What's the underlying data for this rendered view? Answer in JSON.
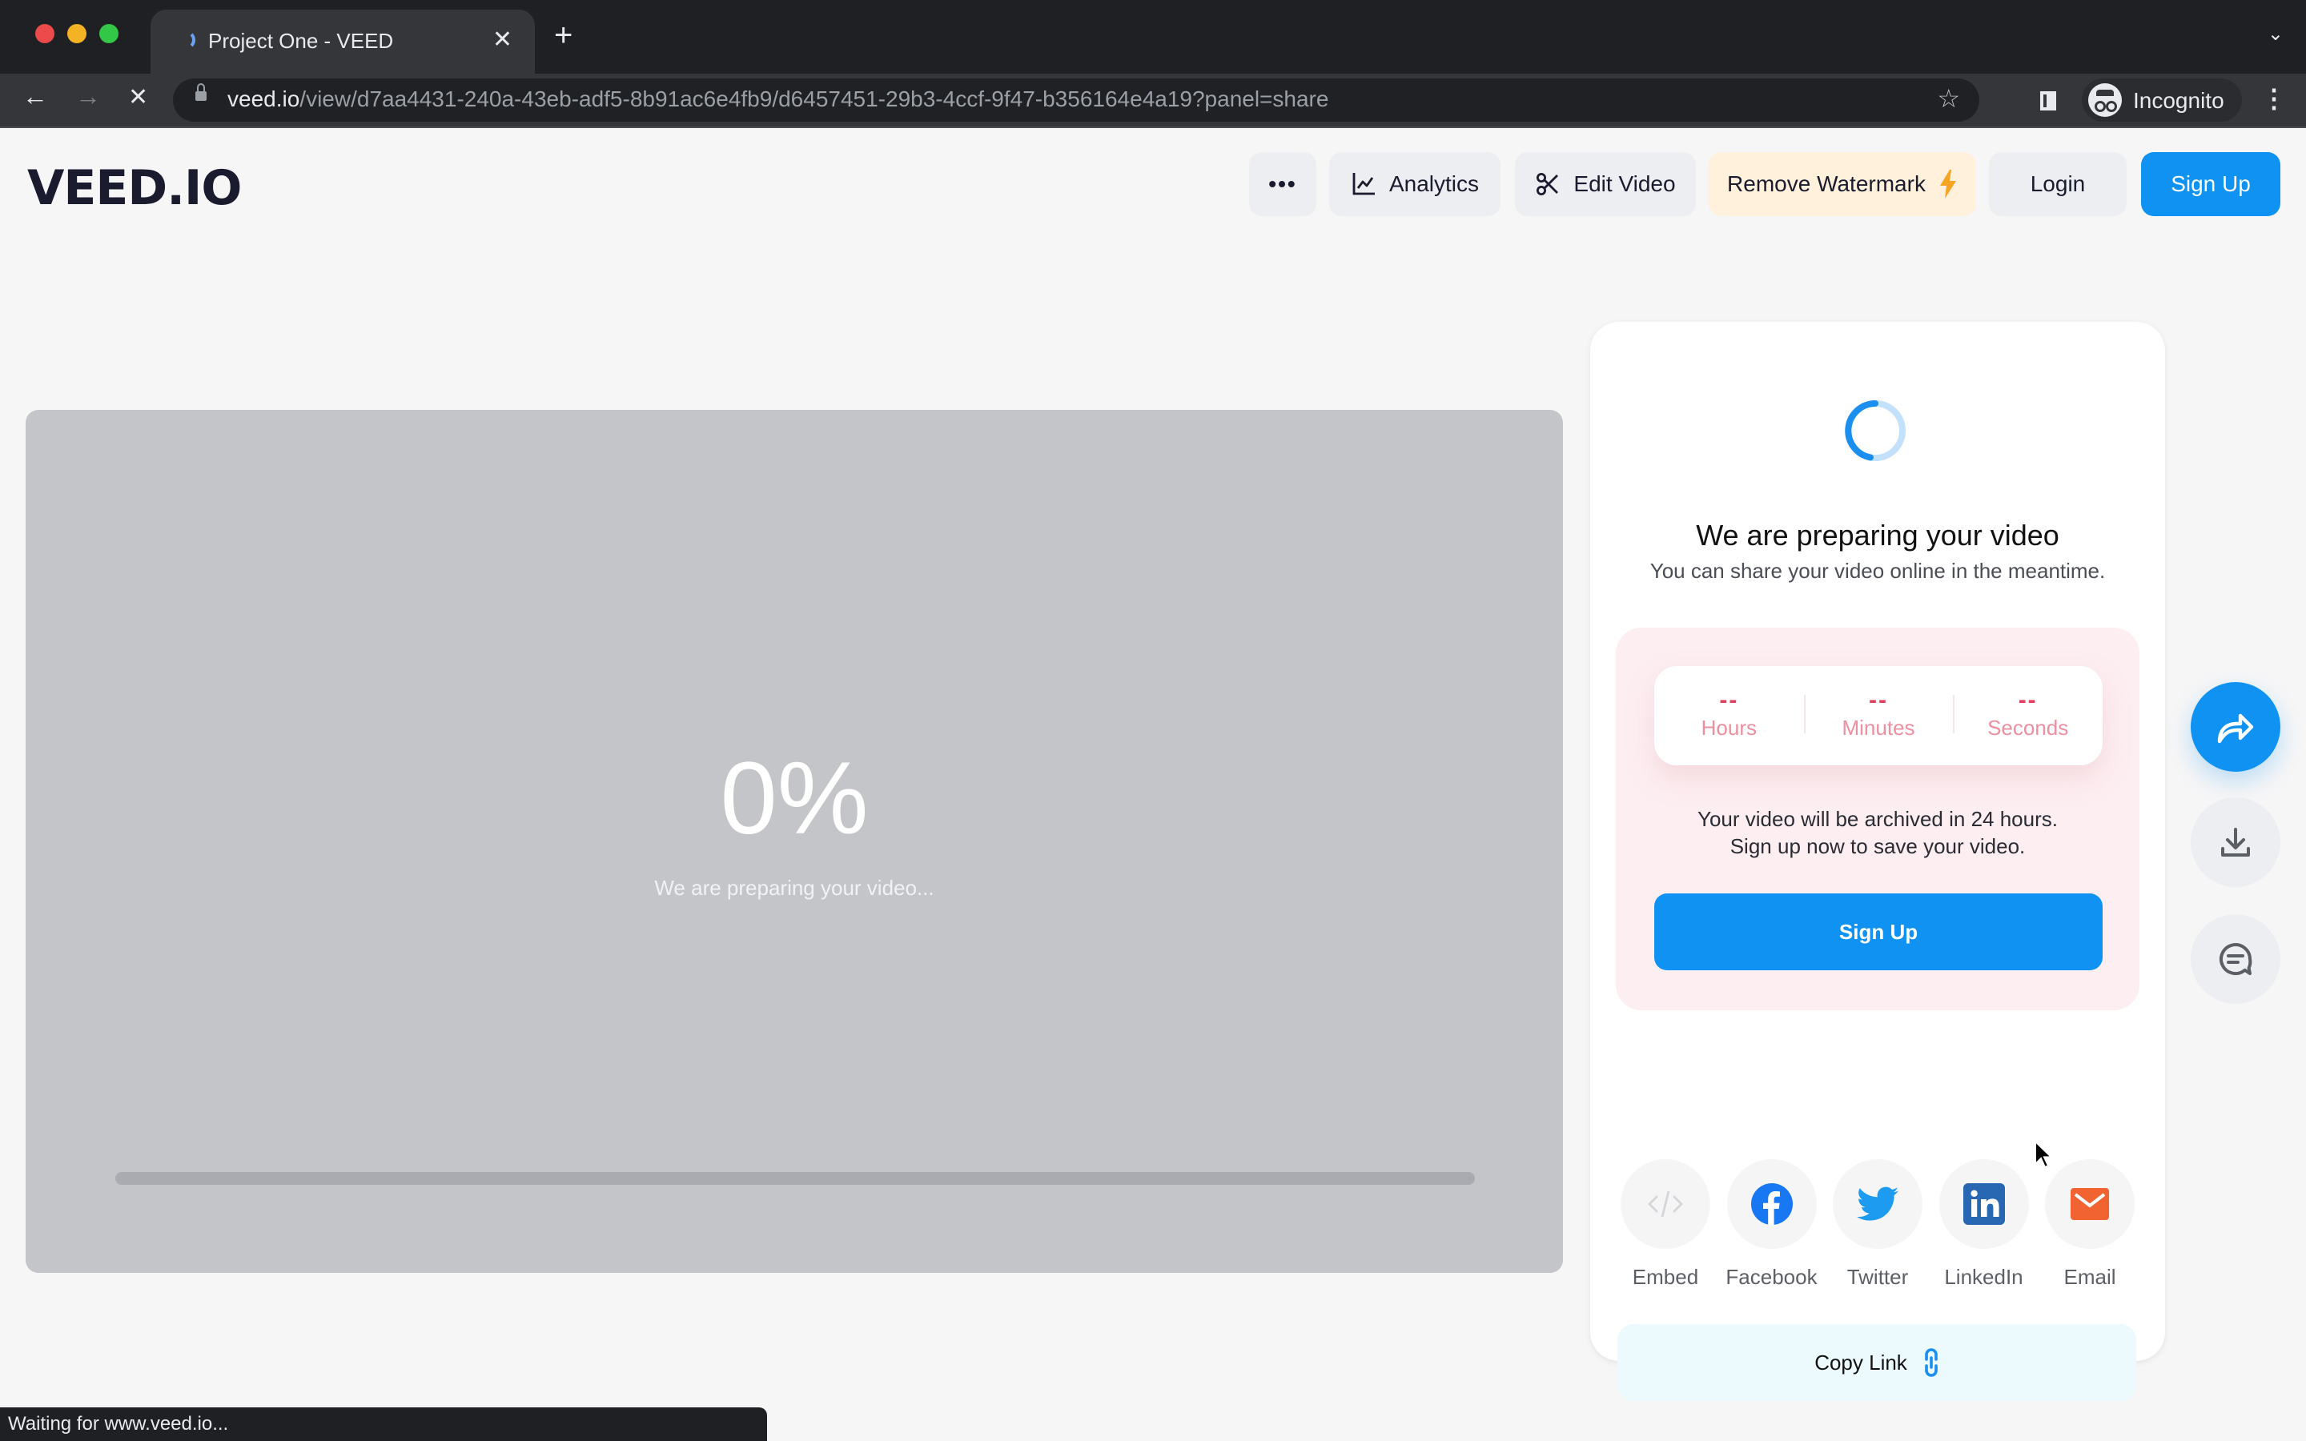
{
  "browser": {
    "tab_title": "Project One - VEED",
    "url_host": "veed.io",
    "url_path": "/view/d7aa4431-240a-43eb-adf5-8b91ac6e4fb9/d6457451-29b3-4ccf-9f47-b356164e4a19?panel=share",
    "profile_label": "Incognito",
    "status_text": "Waiting for www.veed.io..."
  },
  "header": {
    "logo": "VEED.IO",
    "more_label": "•••",
    "analytics_label": "Analytics",
    "edit_label": "Edit Video",
    "watermark_label": "Remove Watermark",
    "login_label": "Login",
    "signup_label": "Sign Up"
  },
  "video": {
    "progress_percent": 0,
    "progress_text": "0%",
    "status_text": "We are preparing your video..."
  },
  "share_panel": {
    "title": "We are preparing your video",
    "subtitle": "You can share your video online in the meantime.",
    "countdown": [
      {
        "value": "--",
        "label": "Hours"
      },
      {
        "value": "--",
        "label": "Minutes"
      },
      {
        "value": "--",
        "label": "Seconds"
      }
    ],
    "archive_line1": "Your video will be archived in 24 hours.",
    "archive_line2": "Sign up now to save your video.",
    "signup_label": "Sign Up",
    "share_targets": [
      {
        "label": "Embed",
        "icon": "embed-icon"
      },
      {
        "label": "Facebook",
        "icon": "facebook-icon"
      },
      {
        "label": "Twitter",
        "icon": "twitter-icon"
      },
      {
        "label": "LinkedIn",
        "icon": "linkedin-icon"
      },
      {
        "label": "Email",
        "icon": "email-icon"
      }
    ],
    "copy_link_label": "Copy Link"
  },
  "colors": {
    "brand_blue": "#0f92f2",
    "countdown_red": "#e0405e",
    "watermark_bg": "#fff1dc",
    "facebook": "#1877f2",
    "twitter": "#1d9bf0",
    "linkedin": "#2867b2",
    "email": "#f26332"
  }
}
